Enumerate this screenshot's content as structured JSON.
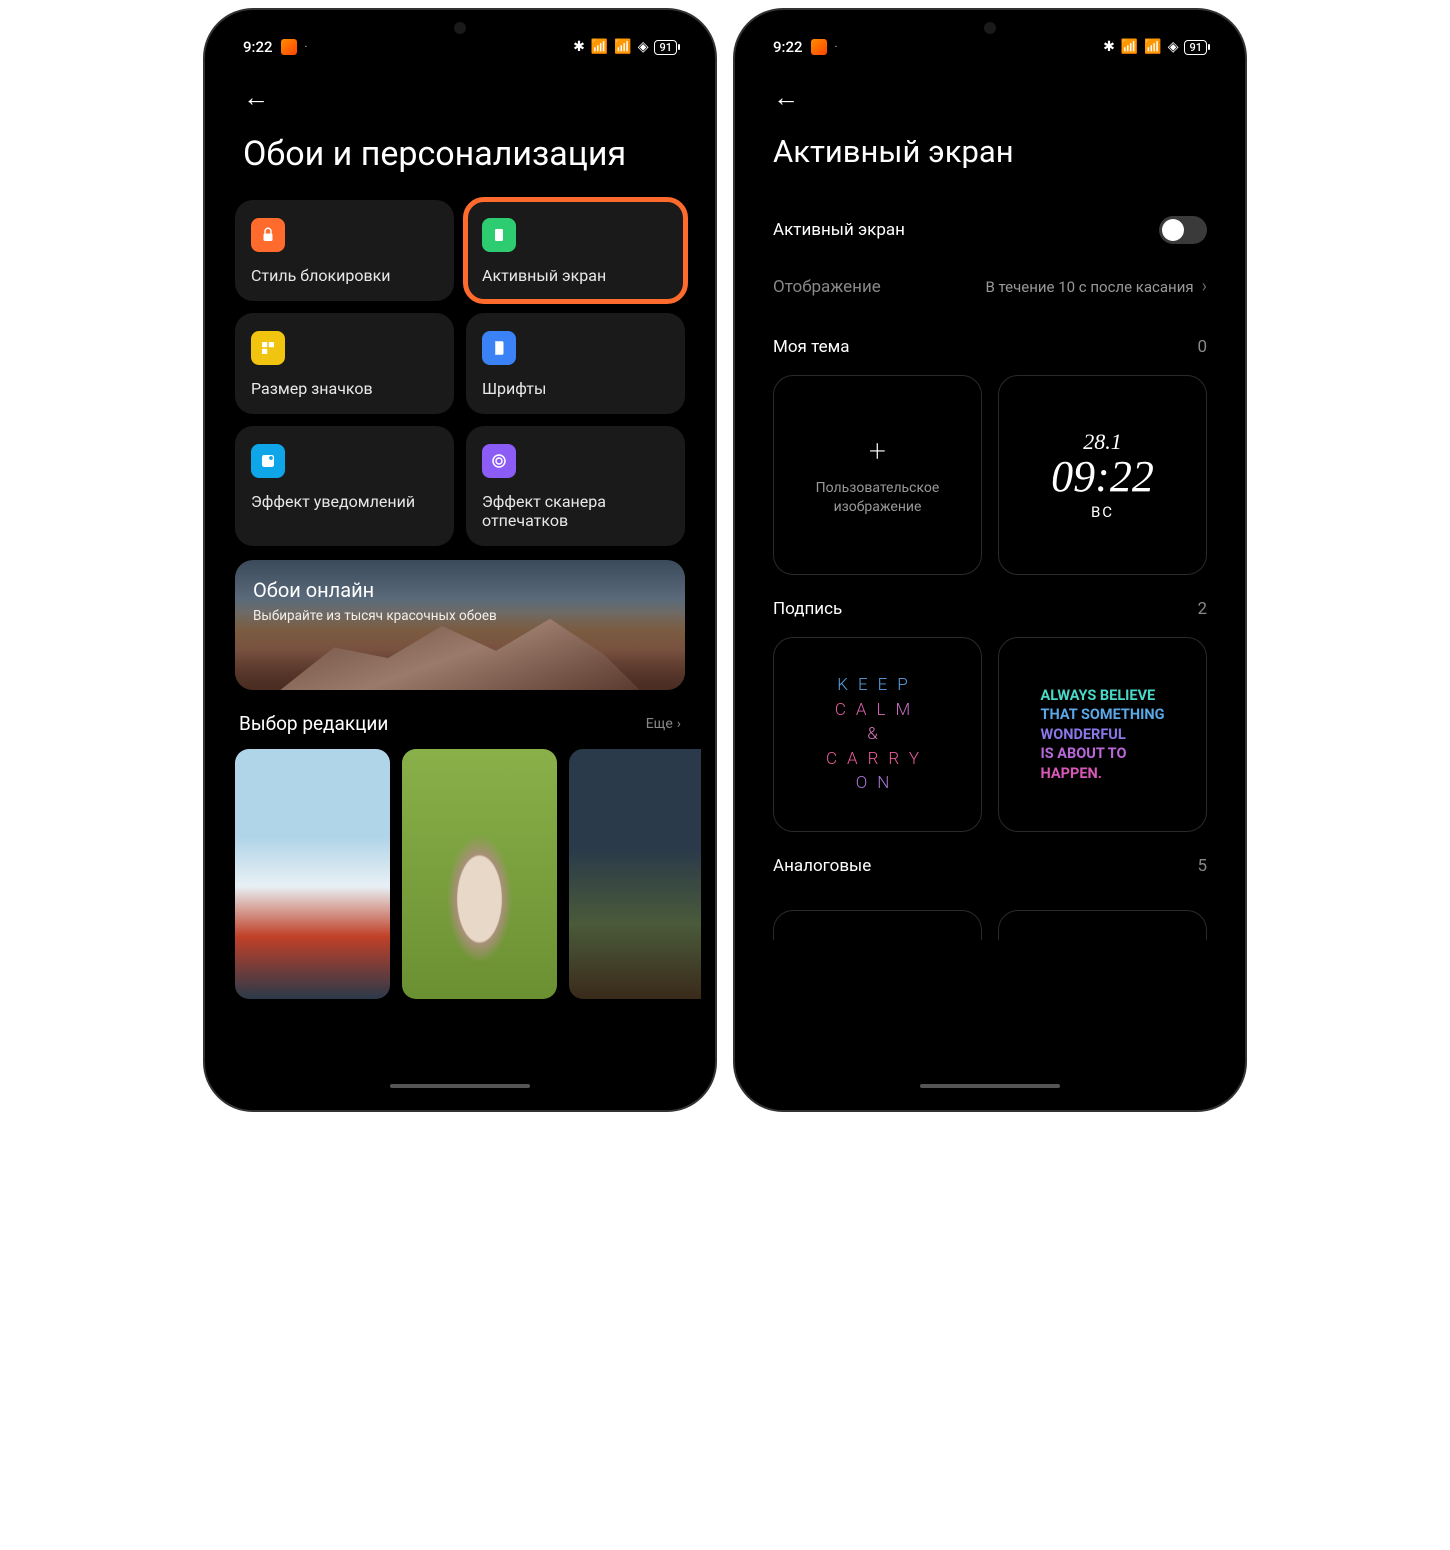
{
  "status": {
    "time": "9:22",
    "battery": "91"
  },
  "left": {
    "title": "Обои и персонализация",
    "tiles": [
      {
        "label": "Стиль блокировки"
      },
      {
        "label": "Активный экран"
      },
      {
        "label": "Размер значков"
      },
      {
        "label": "Шрифты"
      },
      {
        "label": "Эффект уведомлений"
      },
      {
        "label": "Эффект сканера отпечатков"
      }
    ],
    "banner": {
      "title": "Обои онлайн",
      "subtitle": "Выбирайте из тысяч красочных обоев"
    },
    "editors_pick": "Выбор редакции",
    "more": "Еще"
  },
  "right": {
    "title": "Активный экран",
    "toggle_label": "Активный экран",
    "display_label": "Отображение",
    "display_value": "В течение 10 с после касания",
    "my_theme": {
      "label": "Моя тема",
      "count": "0"
    },
    "custom_image_label": "Пользовательское изображение",
    "clock": {
      "date": "28.1",
      "time": "09:22",
      "day": "ВС"
    },
    "signature": {
      "label": "Подпись",
      "count": "2"
    },
    "keepcalm": {
      "l1": "KEEP",
      "l2": "CALM",
      "l3": "&",
      "l4": "CARRY",
      "l5": "ON"
    },
    "believe": {
      "l1": "ALWAYS BELIEVE",
      "l2": "THAT SOMETHING",
      "l3": "WONDERFUL",
      "l4": "IS ABOUT TO",
      "l5": "HAPPEN."
    },
    "analog": {
      "label": "Аналоговые",
      "count": "5"
    }
  }
}
